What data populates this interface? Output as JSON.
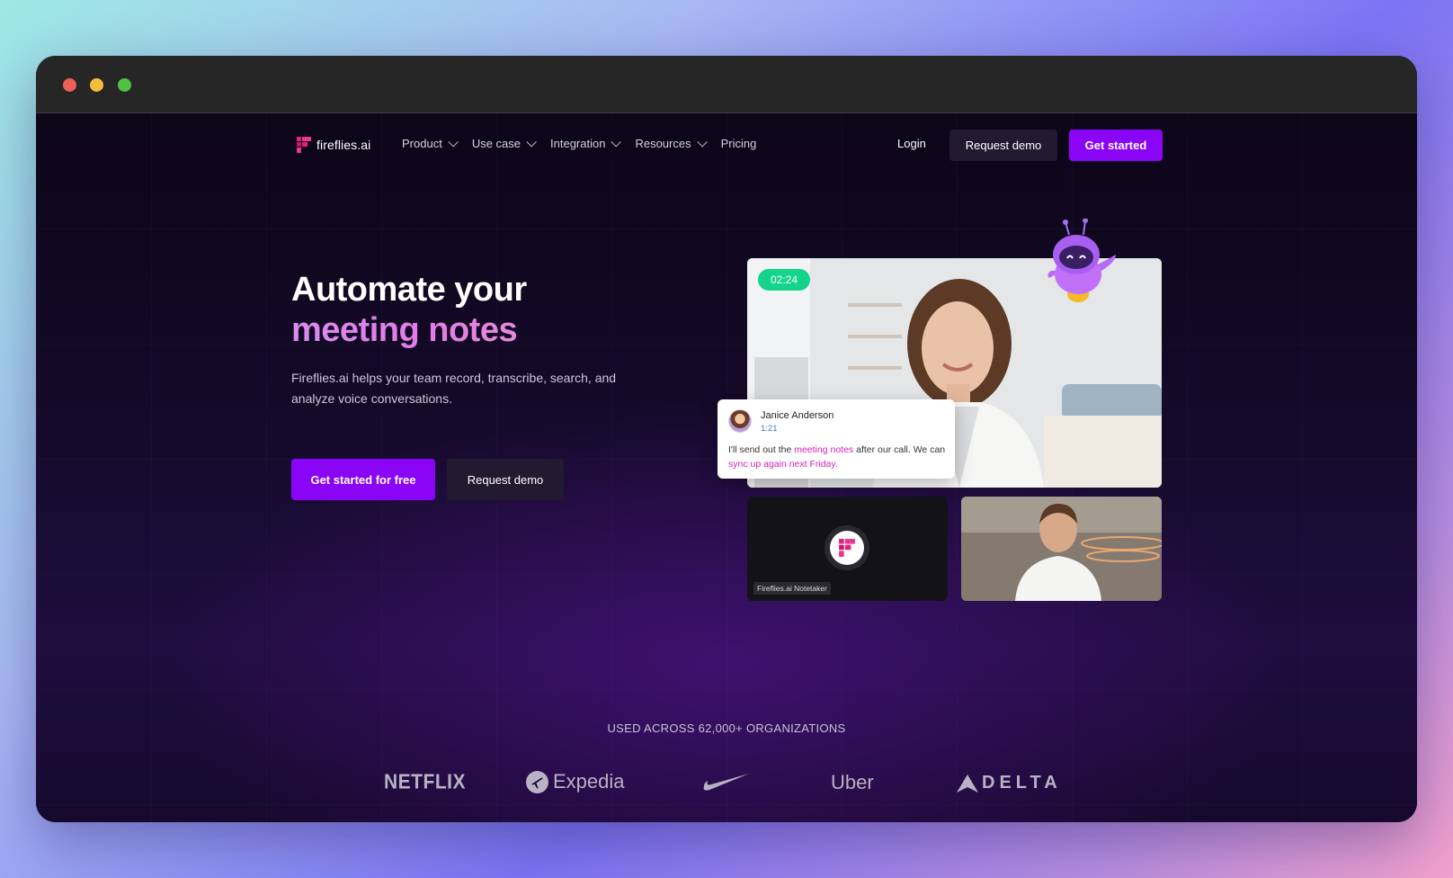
{
  "nav": {
    "logo_text": "fireflies.ai",
    "items": [
      {
        "label": "Product",
        "has_dropdown": true
      },
      {
        "label": "Use case",
        "has_dropdown": true
      },
      {
        "label": "Integration",
        "has_dropdown": true
      },
      {
        "label": "Resources",
        "has_dropdown": true
      },
      {
        "label": "Pricing",
        "has_dropdown": false
      }
    ],
    "login_label": "Login",
    "request_demo_label": "Request demo",
    "get_started_label": "Get started"
  },
  "hero": {
    "title_line1": "Automate your",
    "title_line2": "meeting notes",
    "subtitle": "Fireflies.ai helps your team record, transcribe, search, and analyze voice conversations.",
    "primary_cta": "Get started for free",
    "secondary_cta": "Request demo"
  },
  "meeting": {
    "timer": "02:24",
    "speaker_name": "Janice Anderson",
    "speaker_time": "1:21",
    "quote_part1": "I'll send out the ",
    "quote_highlight1": "meeting notes",
    "quote_part2": " after our call. We can ",
    "quote_highlight2": "sync up again next Friday.",
    "notetaker_label": "Fireflies.ai Notetaker"
  },
  "social_proof": {
    "heading": "USED ACROSS 62,000+ ORGANIZATIONS",
    "logos": [
      "NETFLIX",
      "Expedia",
      "Nike",
      "Uber",
      "DELTA"
    ]
  },
  "colors": {
    "accent": "#8a05f5",
    "timer_green": "#14d38a",
    "highlight_pink": "#d61fb5"
  }
}
